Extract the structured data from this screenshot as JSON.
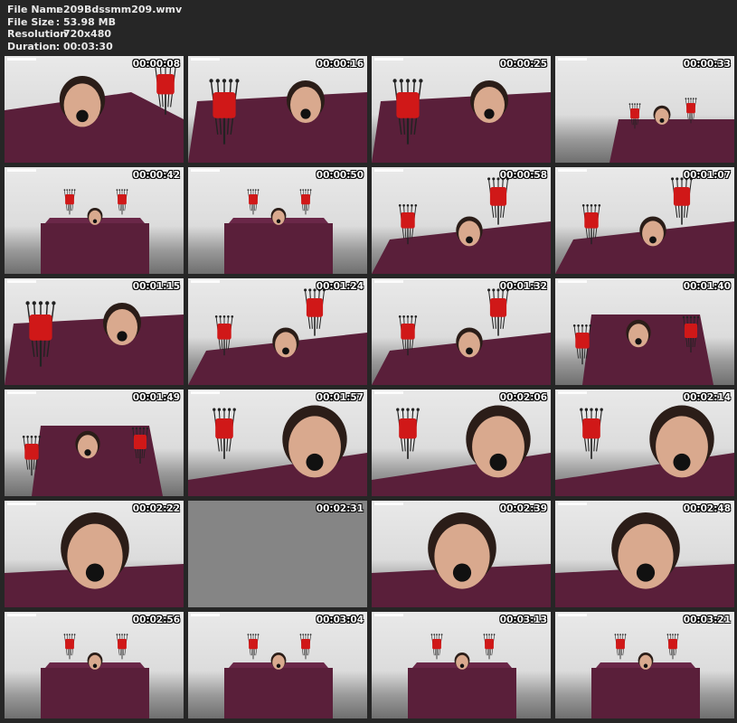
{
  "file_info": {
    "file_name_label": "File Name",
    "file_name": "209Bdssmm209.wmv",
    "file_size_label": "File Size",
    "file_size": "53.98 MB",
    "resolution_label": "Resolution",
    "resolution": "720x480",
    "duration_label": "Duration",
    "duration": "00:03:30",
    "separator": ":"
  },
  "colors": {
    "background": "#262626",
    "cloth": "#5a1f3a",
    "candle": "#d01818",
    "timestamp": "#ffffff"
  },
  "thumbnails": [
    {
      "time": "00:00:08",
      "scene": "closeup-left"
    },
    {
      "time": "00:00:16",
      "scene": "closeup-candle-left"
    },
    {
      "time": "00:00:25",
      "scene": "closeup-candle-left"
    },
    {
      "time": "00:00:33",
      "scene": "wide-small"
    },
    {
      "time": "00:00:42",
      "scene": "wide-table"
    },
    {
      "time": "00:00:50",
      "scene": "wide-table"
    },
    {
      "time": "00:00:58",
      "scene": "mid-two-candles"
    },
    {
      "time": "00:01:07",
      "scene": "mid-two-candles"
    },
    {
      "time": "00:01:15",
      "scene": "closeup-candle-left"
    },
    {
      "time": "00:01:24",
      "scene": "mid-two-candles"
    },
    {
      "time": "00:01:32",
      "scene": "mid-two-candles"
    },
    {
      "time": "00:01:40",
      "scene": "mid-diamond"
    },
    {
      "time": "00:01:49",
      "scene": "mid-diamond"
    },
    {
      "time": "00:01:57",
      "scene": "face-closeup"
    },
    {
      "time": "00:02:06",
      "scene": "face-closeup"
    },
    {
      "time": "00:02:14",
      "scene": "face-closeup"
    },
    {
      "time": "00:02:22",
      "scene": "face-big"
    },
    {
      "time": "00:02:31",
      "scene": "gray"
    },
    {
      "time": "00:02:39",
      "scene": "face-big"
    },
    {
      "time": "00:02:48",
      "scene": "face-big"
    },
    {
      "time": "00:02:56",
      "scene": "wide-table"
    },
    {
      "time": "00:03:04",
      "scene": "wide-table"
    },
    {
      "time": "00:03:13",
      "scene": "wide-table"
    },
    {
      "time": "00:03:21",
      "scene": "wide-table"
    }
  ]
}
